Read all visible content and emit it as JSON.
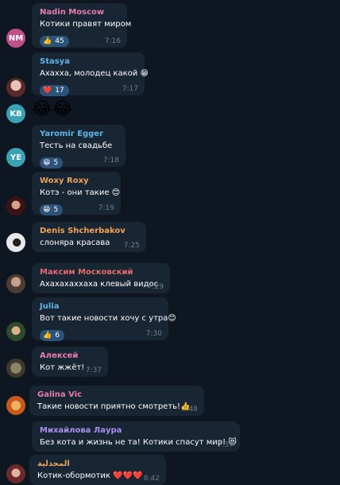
{
  "messages": [
    {
      "name": "Nadin Moscow",
      "name_color": "#e77bb0",
      "avatar": "NM",
      "avatar_color": "#c0508a",
      "text": "Котики правят миром",
      "emoji": "",
      "time": "7:16",
      "reaction": {
        "icon": "👍",
        "count": "45"
      }
    },
    {
      "name": "Stasya",
      "name_color": "#5fb5e8",
      "avatar": "",
      "avatar_color": "#a46e63",
      "text": "Ахахха, молодец какой",
      "emoji": "😁",
      "time": "7:17",
      "reaction": {
        "icon": "❤️",
        "count": "17"
      }
    },
    {
      "avatar": "KB",
      "avatar_color": "#3aa3b3",
      "big_emoji": "😂😂"
    },
    {
      "name": "Yaromir Egger",
      "name_color": "#5fb5e8",
      "avatar": "YE",
      "avatar_color": "#3aa3b3",
      "text": "Тесть на свадьбе",
      "emoji": "",
      "time": "7:18",
      "reaction": {
        "icon": "😁",
        "count": "5"
      }
    },
    {
      "name": "Woxy Roxy",
      "name_color": "#e8a35e",
      "avatar": "",
      "avatar_color": "#7a3b3b",
      "text": "Котэ - они такие",
      "emoji": "😊",
      "time": "7:19",
      "reaction": {
        "icon": "😁",
        "count": "5"
      }
    },
    {
      "name": "Denis Shcherbakov",
      "name_color": "#f5a14e",
      "avatar": "",
      "avatar_color": "#d9d9d9",
      "text": "слоняра красава",
      "emoji": "",
      "time": "7:25"
    },
    {
      "name": "Максим Московский",
      "name_color": "#e56a6a",
      "avatar": "",
      "avatar_color": "#8a7066",
      "text": "Ахахахаххаха клевый видос",
      "emoji": "",
      "time": "7:29"
    },
    {
      "name": "Julia",
      "name_color": "#5fb5e8",
      "avatar": "",
      "avatar_color": "#5a7a4a",
      "text": "Вот такие новости хочу с утра",
      "emoji": "😊",
      "time": "7:30",
      "reaction": {
        "icon": "👍",
        "count": "6"
      }
    },
    {
      "name": "Алексей",
      "name_color": "#e77bb0",
      "avatar": "",
      "avatar_color": "#6d6a55",
      "text": "Кот жжёт!",
      "emoji": "",
      "time": "7:37"
    },
    {
      "name": "Galina Vic",
      "name_color": "#e77bb0",
      "avatar": "",
      "avatar_color": "#e0803a",
      "text": "Такие новости приятно смотреть!",
      "emoji": "👍",
      "time": "7:48"
    },
    {
      "name": "Михайлова Лаура",
      "name_color": "#a98ff0",
      "avatar": "",
      "avatar_color": "#555",
      "text": "Без кота и жизнь не та! Котики спасут мир!",
      "emoji": "😻",
      "time": "7:57"
    },
    {
      "name": "المجدلية",
      "name_color": "#e8a35e",
      "avatar": "",
      "avatar_color": "#b25a5a",
      "text": "Котик-обормотик",
      "emoji": "❤️❤️❤️",
      "time": "8:42"
    }
  ]
}
